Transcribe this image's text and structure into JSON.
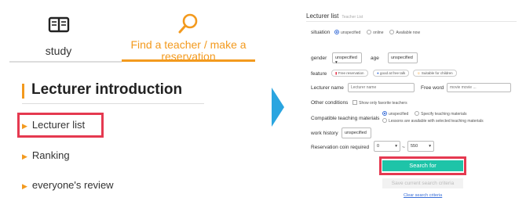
{
  "left_panel": {
    "tabs": [
      {
        "label": "study",
        "icon": "book-icon"
      },
      {
        "label": "Find a teacher / make a reservation",
        "icon": "search-icon"
      }
    ],
    "heading": "Lecturer introduction",
    "nav_items": [
      {
        "label": "Lecturer list"
      },
      {
        "label": "Ranking"
      },
      {
        "label": "everyone's review"
      }
    ]
  },
  "colors": {
    "accent": "#f39a1e",
    "highlight": "#e53950",
    "primary_button": "#1ec4a8",
    "arrow": "#2aa5e0"
  },
  "search_form": {
    "title": "Lecturer list",
    "title_sub": "Teacher List",
    "situation": {
      "label": "situation",
      "options": [
        "unspecified",
        "online",
        "Available now"
      ],
      "selected": "unspecified"
    },
    "gender": {
      "label": "gender",
      "value": "unspecified"
    },
    "age": {
      "label": "age",
      "value": "unspecified"
    },
    "feature": {
      "label": "feature",
      "chips": [
        "Free reservation",
        "good at free talk",
        "Suitable for children"
      ]
    },
    "lecturer_name": {
      "label": "Lecturer name",
      "placeholder": "Lecturer name"
    },
    "free_word": {
      "label": "Free word",
      "placeholder": "movie movie ..."
    },
    "other_conditions": {
      "label": "Other conditions",
      "checkbox": "Show only favorite teachers"
    },
    "materials": {
      "label": "Compatible teaching materials",
      "options": [
        "unspecified",
        "Specify teaching materials",
        "Lessons are available with selected teaching materials"
      ],
      "selected": "unspecified"
    },
    "work_history": {
      "label": "work history",
      "value": "unspecified"
    },
    "coin": {
      "label": "Reservation coin required",
      "min": "0",
      "separator": "~",
      "max": "550"
    },
    "search_button": "Search for",
    "save_button": "Save current search criteria",
    "clear_link": "Clear search criteria"
  }
}
